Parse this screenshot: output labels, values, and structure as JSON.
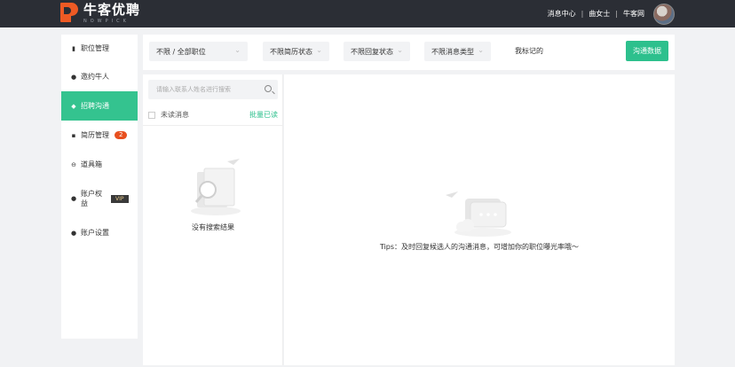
{
  "header": {
    "logo_title": "牛客优聘",
    "logo_sub": "NOWPICK",
    "nav": [
      "消息中心",
      "曲女士",
      "牛客网"
    ],
    "separator": "|"
  },
  "sidebar": {
    "items": [
      {
        "label": "职位管理",
        "icon": "pin-icon",
        "glyph": "📌"
      },
      {
        "label": "邀约牛人",
        "icon": "user-icon",
        "glyph": "👤"
      },
      {
        "label": "招聘沟通",
        "icon": "chat-icon",
        "glyph": "💬",
        "active": true
      },
      {
        "label": "简历管理",
        "icon": "resume-icon",
        "glyph": "📄",
        "badge": "2"
      },
      {
        "label": "道具箱",
        "icon": "toolbox-icon",
        "glyph": "⊖"
      },
      {
        "label": "账户权益",
        "icon": "rights-icon",
        "glyph": "♛",
        "tag": "VIP"
      },
      {
        "label": "账户设置",
        "icon": "settings-icon",
        "glyph": "👤"
      }
    ]
  },
  "filters": {
    "job": "不限 / 全部职位",
    "resume_status": "不限简历状态",
    "reply_status": "不限回复状态",
    "message_type": "不限消息类型",
    "marked": "我标记的",
    "data_button": "沟通数据"
  },
  "list": {
    "search_placeholder": "请输入联系人姓名进行搜索",
    "unread_label": "未读消息",
    "mark_all_read": "批量已读",
    "empty_text": "没有搜索结果"
  },
  "chat": {
    "tips": "Tips：及时回复候选人的沟通消息，可增加你的职位曝光率哦～"
  },
  "colors": {
    "accent": "#2dc08d",
    "topbar": "#2b2e35",
    "brand": "#ee5a24",
    "badge": "#e8501f"
  }
}
